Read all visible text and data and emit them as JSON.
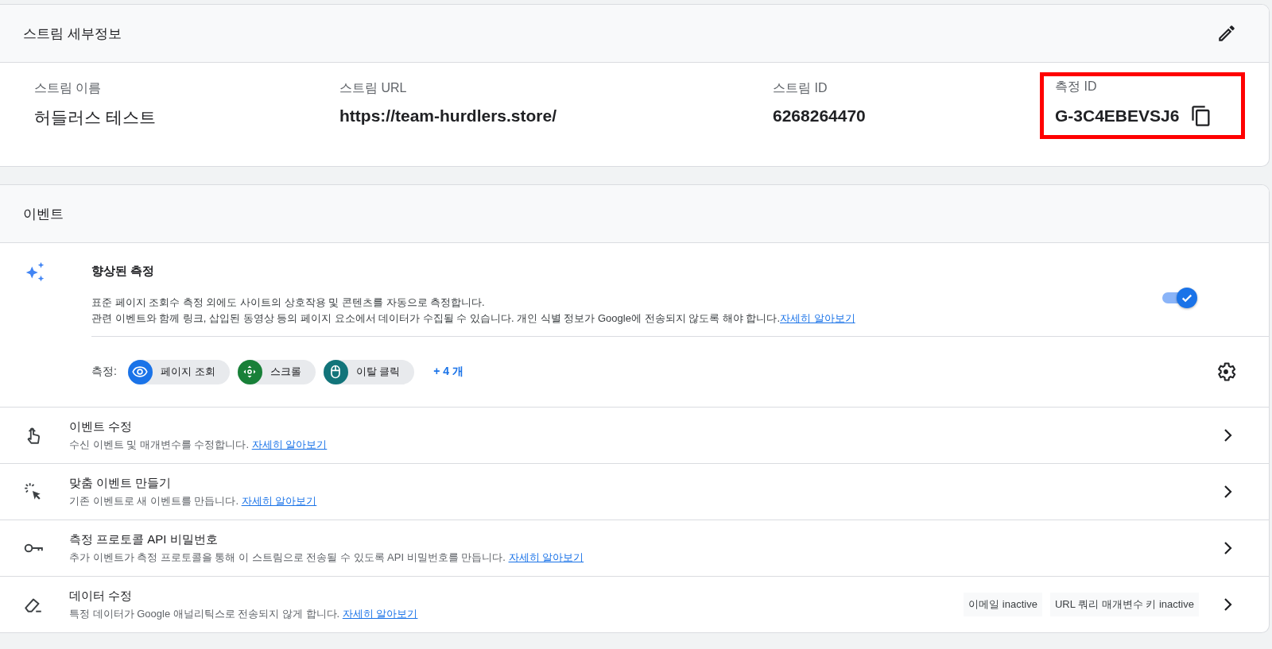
{
  "stream_details": {
    "title": "스트림 세부정보",
    "fields": [
      {
        "label": "스트림 이름",
        "value": "허들러스 테스트",
        "copyable": false,
        "highlighted": false
      },
      {
        "label": "스트림 URL",
        "value": "https://team-hurdlers.store/",
        "copyable": false,
        "highlighted": false
      },
      {
        "label": "스트림 ID",
        "value": "6268264470",
        "copyable": false,
        "highlighted": false
      },
      {
        "label": "측정 ID",
        "value": "G-3C4EBEVSJ6",
        "copyable": true,
        "highlighted": true
      }
    ]
  },
  "events": {
    "title": "이벤트",
    "enhanced_measurement": {
      "title": "향상된 측정",
      "description_lines": [
        "표준 페이지 조회수 측정 외에도 사이트의 상호작용 및 콘텐츠를 자동으로 측정합니다.",
        "관련 이벤트와 함께 링크, 삽입된 동영상 등의 페이지 요소에서 데이터가 수집될 수 있습니다. 개인 식별 정보가 Google에 전송되지 않도록 해야 합니다."
      ],
      "link": "자세히 알아보기",
      "on": true,
      "measurements_label": "측정:",
      "chips": [
        {
          "kind": "eye",
          "label": "페이지 조회",
          "color": "#1a73e8"
        },
        {
          "kind": "scroll",
          "label": "스크롤",
          "color": "#188038"
        },
        {
          "kind": "mouse",
          "label": "이탈 클릭",
          "color": "#12747a"
        }
      ],
      "more": "+ 4 개"
    },
    "rows": [
      {
        "kind": "touch",
        "title": "이벤트 수정",
        "description": "수신 이벤트 및 매개변수를 수정합니다.",
        "link": "자세히 알아보기",
        "tags": []
      },
      {
        "kind": "click",
        "title": "맞춤 이벤트 만들기",
        "description": "기존 이벤트로 새 이벤트를 만듭니다.",
        "link": "자세히 알아보기",
        "tags": []
      },
      {
        "kind": "key",
        "title": "측정 프로토콜 API 비밀번호",
        "description": "추가 이벤트가 측정 프로토콜을 통해 이 스트림으로 전송될 수 있도록 API 비밀번호를 만듭니다.",
        "link": "자세히 알아보기",
        "tags": []
      },
      {
        "kind": "eraser",
        "title": "데이터 수정",
        "description": "특정 데이터가 Google 애널리틱스로 전송되지 않게 합니다.",
        "link": "자세히 알아보기",
        "tags": [
          "이메일 inactive",
          "URL 쿼리 매개변수 키 inactive"
        ]
      }
    ]
  }
}
